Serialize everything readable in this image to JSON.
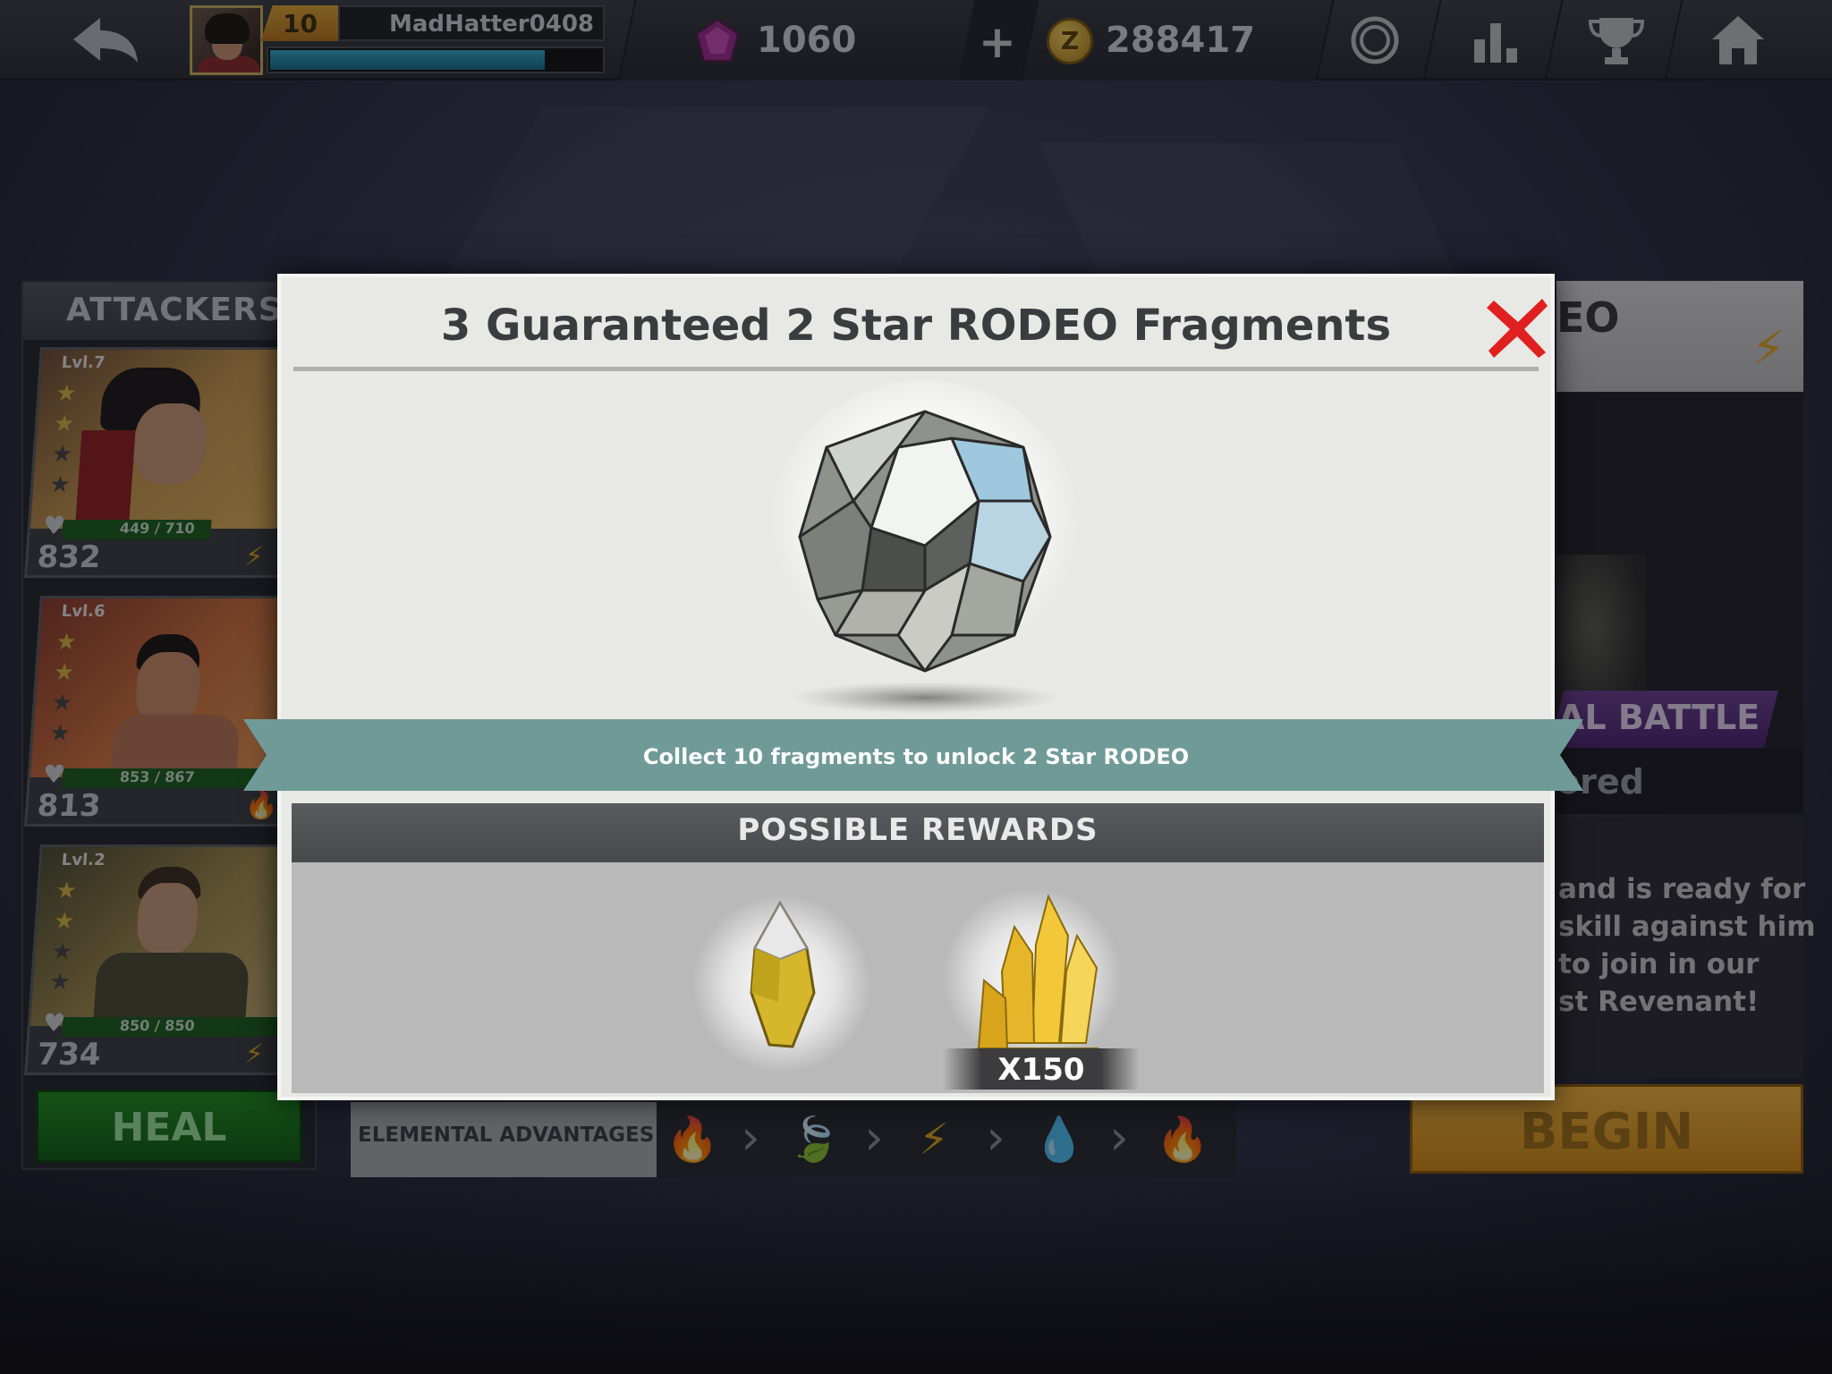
{
  "topbar": {
    "player_level": "10",
    "player_name": "MadHatter0408",
    "xp_progress": 0.83,
    "gems": "1060",
    "coins": "288417"
  },
  "attackers": {
    "title": "ATTACKERS",
    "cards": [
      {
        "level": "Lvl.7",
        "stars_filled": 2,
        "stars_total": 4,
        "hp": "449 / 710",
        "hp_fraction": 0.63,
        "power": "832",
        "element": "lightning"
      },
      {
        "level": "Lvl.6",
        "stars_filled": 2,
        "stars_total": 4,
        "hp": "853 / 867",
        "hp_fraction": 0.98,
        "power": "813",
        "element": "fire"
      },
      {
        "level": "Lvl.2",
        "stars_filled": 2,
        "stars_total": 4,
        "hp": "850 / 850",
        "hp_fraction": 1.0,
        "power": "734",
        "element": "lightning"
      }
    ],
    "heal_label": "HEAL"
  },
  "elemental": {
    "label": "ELEMENTAL ADVANTAGES",
    "icons": [
      "fire-icon",
      "leaf-icon",
      "lightning-icon",
      "water-icon",
      "fire-icon"
    ]
  },
  "right": {
    "title_fragment": "EO",
    "battle_fragment": "AL BATTLE",
    "ored_fragment": "ored",
    "desc_lines": [
      "and is ready for",
      "skill against him",
      "to join in our",
      "st Revenant!"
    ],
    "begin_label": "BEGIN"
  },
  "modal": {
    "title": "3 Guaranteed 2 Star RODEO Fragments",
    "ribbon_text": "Collect 10 fragments to unlock 2 Star RODEO",
    "rewards_title": "POSSIBLE REWARDS",
    "reward_quantity": "X150"
  },
  "colors": {
    "accent_gold": "#e2a418",
    "heal_green": "#1d8c1d",
    "ribbon_teal": "#6f9a98",
    "close_red": "#e02020",
    "battle_purple": "#5c2f80"
  }
}
